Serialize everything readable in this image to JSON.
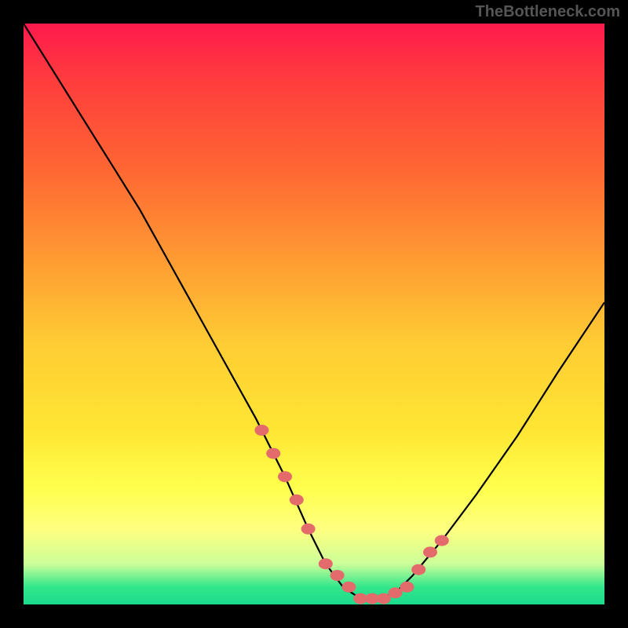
{
  "watermark": "TheBottleneck.com",
  "chart_data": {
    "type": "line",
    "title": "",
    "xlabel": "",
    "ylabel": "",
    "xlim": [
      0,
      100
    ],
    "ylim": [
      0,
      100
    ],
    "series": [
      {
        "name": "curve",
        "x": [
          0,
          5,
          10,
          15,
          20,
          25,
          30,
          35,
          40,
          45,
          49,
          52,
          55,
          58,
          61,
          64,
          67,
          72,
          78,
          85,
          92,
          100
        ],
        "y": [
          100,
          92,
          84,
          76,
          68,
          59,
          50,
          41,
          32,
          22,
          13,
          7,
          3,
          1,
          1,
          2,
          5,
          11,
          19,
          29,
          40,
          52
        ]
      }
    ],
    "markers": {
      "name": "highlight-points",
      "x": [
        41,
        43,
        45,
        47,
        49,
        52,
        54,
        56,
        58,
        60,
        62,
        64,
        66,
        68,
        70,
        72
      ],
      "y": [
        30,
        26,
        22,
        18,
        13,
        7,
        5,
        3,
        1,
        1,
        1,
        2,
        3,
        6,
        9,
        11
      ]
    },
    "gradient_background": {
      "top_color": "#ff1a4d",
      "bottom_color": "#1adb8c",
      "description": "vertical red-to-green gradient"
    }
  }
}
